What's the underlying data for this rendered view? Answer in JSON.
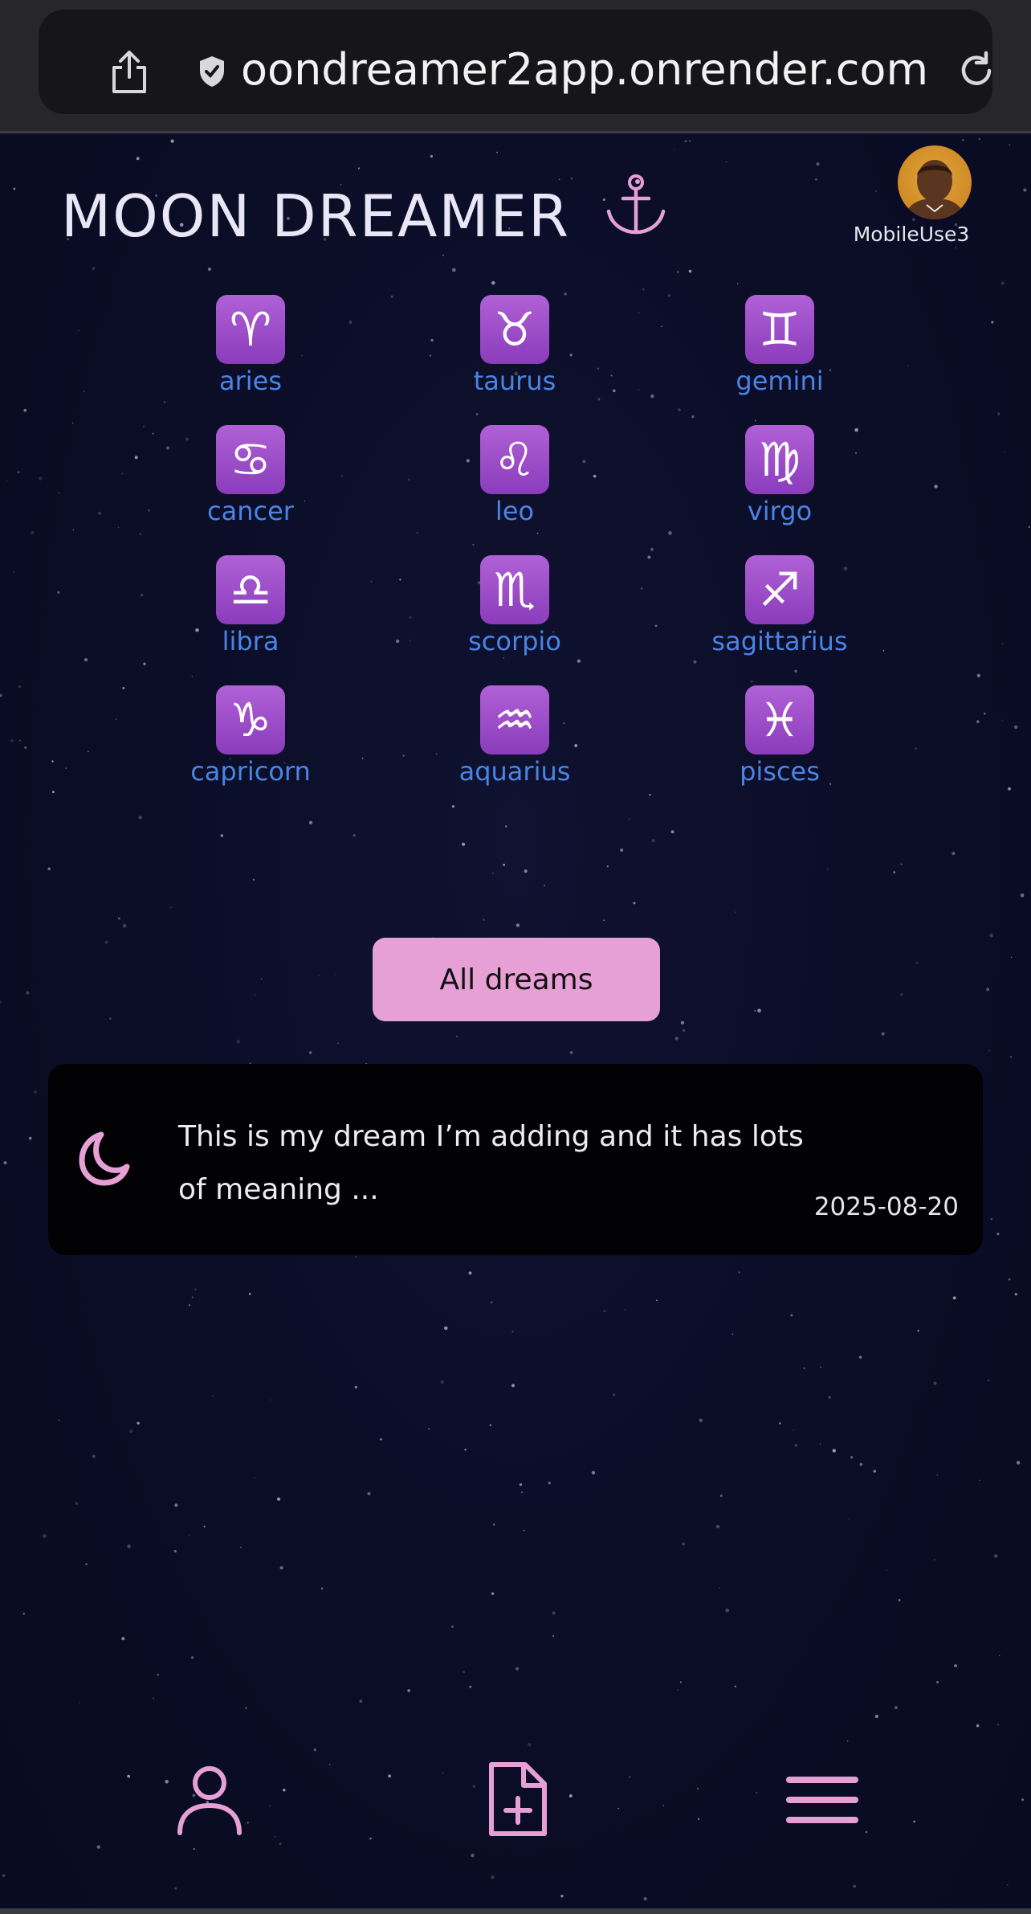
{
  "browser": {
    "url": "oondreamer2app.onrender.com"
  },
  "header": {
    "title": "MOON DREAMER",
    "username": "MobileUse3"
  },
  "zodiac": [
    {
      "glyph": "♈",
      "label": "aries"
    },
    {
      "glyph": "♉",
      "label": "taurus"
    },
    {
      "glyph": "♊",
      "label": "gemini"
    },
    {
      "glyph": "♋",
      "label": "cancer"
    },
    {
      "glyph": "♌",
      "label": "leo"
    },
    {
      "glyph": "♍",
      "label": "virgo"
    },
    {
      "glyph": "♎",
      "label": "libra"
    },
    {
      "glyph": "♏",
      "label": "scorpio"
    },
    {
      "glyph": "♐",
      "label": "sagittarius"
    },
    {
      "glyph": "♑",
      "label": "capricorn"
    },
    {
      "glyph": "♒",
      "label": "aquarius"
    },
    {
      "glyph": "♓",
      "label": "pisces"
    }
  ],
  "actions": {
    "all_dreams_label": "All dreams"
  },
  "dreams": [
    {
      "icon": "moon-icon",
      "text": "This is my dream I’m adding and it has lots of meaning ...",
      "date": "2025-08-20"
    }
  ],
  "nav": {
    "icons": [
      "user-icon",
      "add-file-icon",
      "hamburger-menu-icon"
    ]
  },
  "colors": {
    "background": "#0b0d26",
    "accent_pink": "#e6a0d6",
    "zodiac_label_blue": "#4a84e6",
    "zodiac_tile_purple": "#9b4fc9"
  }
}
